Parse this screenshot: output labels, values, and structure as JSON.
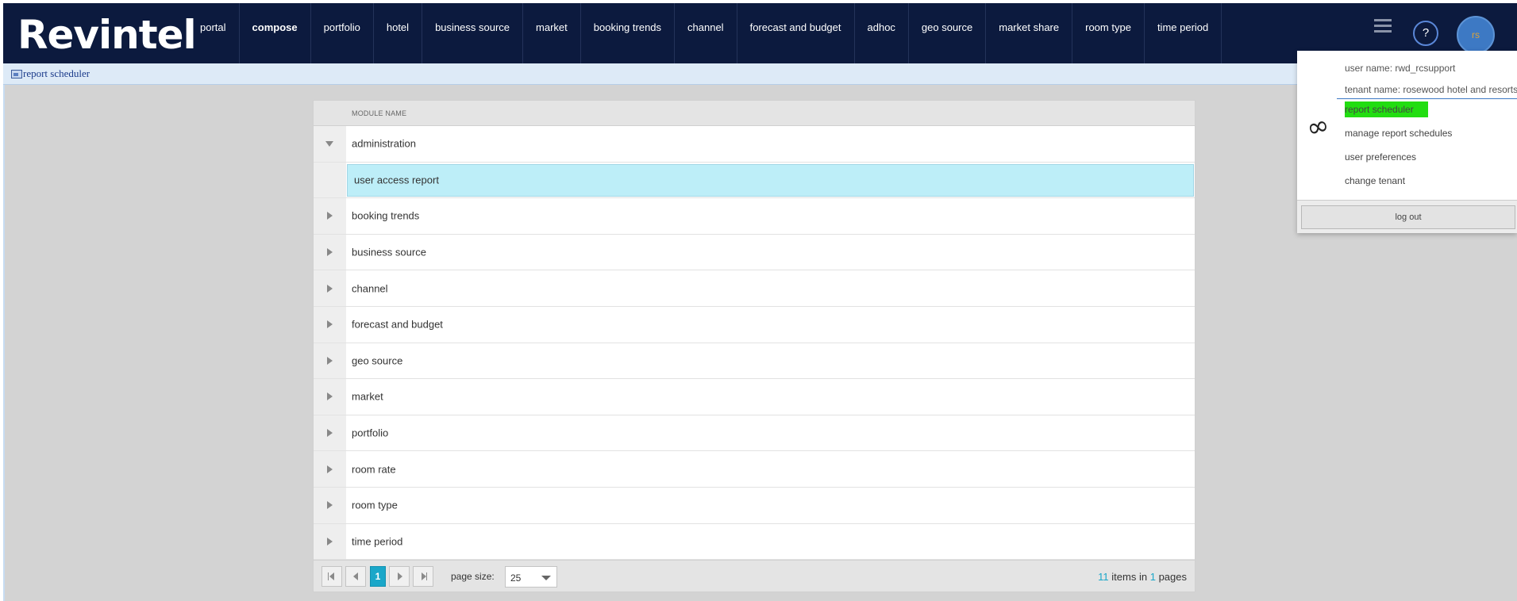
{
  "app": {
    "logo": "Revintel"
  },
  "nav": {
    "items": [
      {
        "label": "portal",
        "bold": false
      },
      {
        "label": "compose",
        "bold": true
      },
      {
        "label": "portfolio",
        "bold": false
      },
      {
        "label": "hotel",
        "bold": false
      },
      {
        "label": "business source",
        "bold": false
      },
      {
        "label": "market",
        "bold": false
      },
      {
        "label": "booking trends",
        "bold": false
      },
      {
        "label": "channel",
        "bold": false
      },
      {
        "label": "forecast and budget",
        "bold": false
      },
      {
        "label": "adhoc",
        "bold": false
      },
      {
        "label": "geo source",
        "bold": false
      },
      {
        "label": "market share",
        "bold": false
      },
      {
        "label": "room type",
        "bold": false
      },
      {
        "label": "time period",
        "bold": false
      }
    ],
    "menu_icon": "hamburger-icon",
    "help_label": "?",
    "avatar_initials": "rs"
  },
  "breadcrumb": {
    "icon": "report-icon",
    "label": "report scheduler"
  },
  "grid": {
    "column_header": "MODULE NAME",
    "rows": [
      {
        "label": "administration",
        "expanded": true,
        "children": [
          "user access report"
        ]
      },
      {
        "label": "booking trends",
        "expanded": false
      },
      {
        "label": "business source",
        "expanded": false
      },
      {
        "label": "channel",
        "expanded": false
      },
      {
        "label": "forecast and budget",
        "expanded": false
      },
      {
        "label": "geo source",
        "expanded": false
      },
      {
        "label": "market",
        "expanded": false
      },
      {
        "label": "portfolio",
        "expanded": false
      },
      {
        "label": "room rate",
        "expanded": false
      },
      {
        "label": "room type",
        "expanded": false
      },
      {
        "label": "time period",
        "expanded": false
      }
    ],
    "pager": {
      "current_page": "1",
      "page_size_label": "page size:",
      "page_size": "25",
      "total_items": "11",
      "items_in_text": "items in",
      "total_pages": "1",
      "pages_text": "pages"
    }
  },
  "user_menu": {
    "icon": "infinity-icon",
    "user_name": "user name: rwd_rcsupport",
    "tenant_name": "tenant name: rosewood hotel and resorts",
    "items": [
      "report scheduler",
      "manage report schedules",
      "user preferences",
      "change tenant"
    ],
    "active_item": "report scheduler",
    "active_color": "#22dd11",
    "logout_label": "log out"
  },
  "colors": {
    "topbar": "#0c1a3e",
    "accent": "#1aa7c9",
    "selected_row": "#bdeef8",
    "background": "#d3d3d3"
  }
}
